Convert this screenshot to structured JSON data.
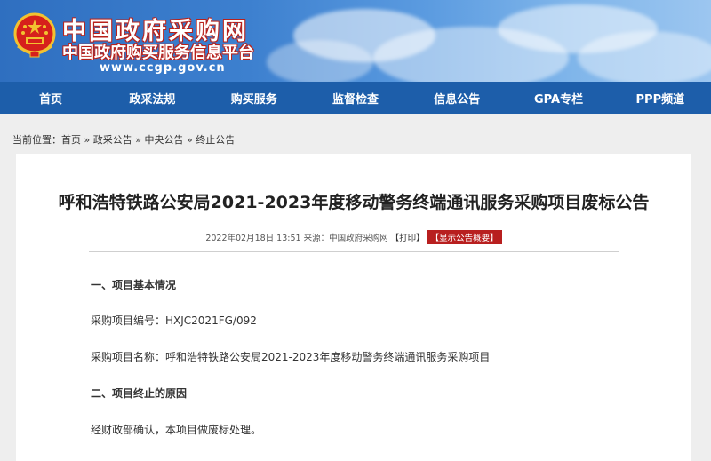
{
  "header": {
    "site_title": "中国政府采购网",
    "site_subtitle": "中国政府购买服务信息平台",
    "site_url": "www.ccgp.gov.cn"
  },
  "nav": {
    "items": [
      {
        "label": "首页"
      },
      {
        "label": "政采法规"
      },
      {
        "label": "购买服务"
      },
      {
        "label": "监督检查"
      },
      {
        "label": "信息公告"
      },
      {
        "label": "GPA专栏"
      },
      {
        "label": "PPP频道"
      }
    ]
  },
  "breadcrumb": {
    "prefix": "当前位置：",
    "items": [
      "首页",
      "政采公告",
      "中央公告",
      "终止公告"
    ],
    "separator": "»"
  },
  "article": {
    "title": "呼和浩特铁路公安局2021-2023年度移动警务终端通讯服务采购项目废标公告",
    "meta_date": "2022年02月18日 13:51 来源：中国政府采购网",
    "print_label": "【打印】",
    "summary_label": "【显示公告概要】",
    "sections": [
      {
        "text": "一、项目基本情况",
        "bold": true
      },
      {
        "text": "采购项目编号：HXJC2021FG/092",
        "bold": false
      },
      {
        "text": "采购项目名称：呼和浩特铁路公安局2021-2023年度移动警务终端通讯服务采购项目",
        "bold": false
      },
      {
        "text": "二、项目终止的原因",
        "bold": true
      },
      {
        "text": "经财政部确认，本项目做废标处理。",
        "bold": false
      }
    ]
  },
  "colors": {
    "nav_bg": "#1d5eaa",
    "accent_red": "#b81f1f"
  }
}
